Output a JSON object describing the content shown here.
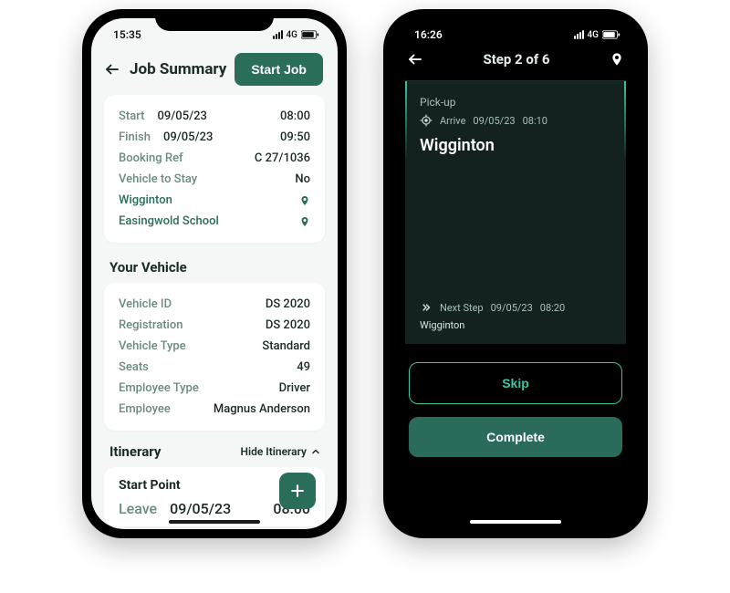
{
  "phone1": {
    "status": {
      "time": "15:35",
      "network": "4G"
    },
    "header": {
      "title": "Job Summary",
      "start_btn": "Start Job"
    },
    "summary": {
      "start_label": "Start",
      "start_date": "09/05/23",
      "start_time": "08:00",
      "finish_label": "Finish",
      "finish_date": "09/05/23",
      "finish_time": "09:50",
      "booking_label": "Booking Ref",
      "booking_val": "C 27/1036",
      "stay_label": "Vehicle to Stay",
      "stay_val": "No",
      "loc1": "Wigginton",
      "loc2": "Easingwold School"
    },
    "vehicle_title": "Your Vehicle",
    "vehicle": {
      "id_label": "Vehicle ID",
      "id_val": "DS 2020",
      "reg_label": "Registration",
      "reg_val": "DS 2020",
      "type_label": "Vehicle Type",
      "type_val": "Standard",
      "seats_label": "Seats",
      "seats_val": "49",
      "emp_type_label": "Employee Type",
      "emp_type_val": "Driver",
      "emp_label": "Employee",
      "emp_val": "Magnus Anderson"
    },
    "itinerary": {
      "title": "Itinerary",
      "hide_label": "Hide Itinerary",
      "step_title": "Start Point",
      "leave_label": "Leave",
      "leave_date": "09/05/23",
      "leave_time": "08:00"
    }
  },
  "phone2": {
    "status": {
      "time": "16:26",
      "network": "4G"
    },
    "header": {
      "step_title": "Step 2 of 6"
    },
    "card": {
      "pickup_label": "Pick-up",
      "arrive_label": "Arrive",
      "arrive_date": "09/05/23",
      "arrive_time": "08:10",
      "place": "Wigginton",
      "next_label": "Next Step",
      "next_date": "09/05/23",
      "next_time": "08:20",
      "next_loc": "Wigginton"
    },
    "buttons": {
      "skip": "Skip",
      "complete": "Complete"
    }
  }
}
